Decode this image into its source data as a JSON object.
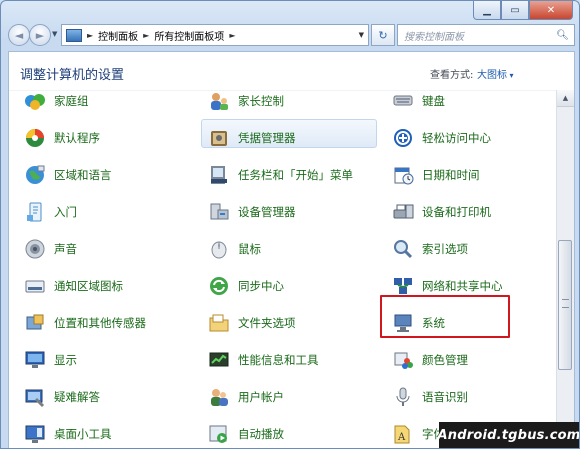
{
  "window": {
    "caption_minimize": "▁",
    "caption_maximize": "▭",
    "caption_close": "✕"
  },
  "nav": {
    "back_glyph": "◄",
    "forward_glyph": "►",
    "breadcrumb": [
      "控制面板",
      "所有控制面板项"
    ],
    "separator": "►",
    "refresh_glyph": "↻"
  },
  "search": {
    "placeholder": "搜索控制面板"
  },
  "header": {
    "title": "调整计算机的设置",
    "view_label": "查看方式:",
    "view_value": "大图标"
  },
  "items": [
    {
      "label": "家庭组",
      "icon": "homegroup-icon"
    },
    {
      "label": "家长控制",
      "icon": "parental-controls-icon"
    },
    {
      "label": "键盘",
      "icon": "keyboard-icon"
    },
    {
      "label": "默认程序",
      "icon": "default-programs-icon"
    },
    {
      "label": "凭据管理器",
      "icon": "credential-manager-icon"
    },
    {
      "label": "轻松访问中心",
      "icon": "ease-of-access-icon"
    },
    {
      "label": "区域和语言",
      "icon": "region-language-icon"
    },
    {
      "label": "任务栏和「开始」菜单",
      "icon": "taskbar-icon"
    },
    {
      "label": "日期和时间",
      "icon": "date-time-icon"
    },
    {
      "label": "入门",
      "icon": "getting-started-icon"
    },
    {
      "label": "设备管理器",
      "icon": "device-manager-icon"
    },
    {
      "label": "设备和打印机",
      "icon": "devices-printers-icon"
    },
    {
      "label": "声音",
      "icon": "sound-icon"
    },
    {
      "label": "鼠标",
      "icon": "mouse-icon"
    },
    {
      "label": "索引选项",
      "icon": "indexing-options-icon"
    },
    {
      "label": "通知区域图标",
      "icon": "notification-area-icon"
    },
    {
      "label": "同步中心",
      "icon": "sync-center-icon"
    },
    {
      "label": "网络和共享中心",
      "icon": "network-sharing-icon"
    },
    {
      "label": "位置和其他传感器",
      "icon": "location-sensors-icon"
    },
    {
      "label": "文件夹选项",
      "icon": "folder-options-icon"
    },
    {
      "label": "系统",
      "icon": "system-icon"
    },
    {
      "label": "显示",
      "icon": "display-icon"
    },
    {
      "label": "性能信息和工具",
      "icon": "performance-icon"
    },
    {
      "label": "颜色管理",
      "icon": "color-management-icon"
    },
    {
      "label": "疑难解答",
      "icon": "troubleshooting-icon"
    },
    {
      "label": "用户帐户",
      "icon": "user-accounts-icon"
    },
    {
      "label": "语音识别",
      "icon": "speech-recognition-icon"
    },
    {
      "label": "桌面小工具",
      "icon": "desktop-gadgets-icon"
    },
    {
      "label": "自动播放",
      "icon": "autoplay-icon"
    },
    {
      "label": "字体",
      "icon": "fonts-icon"
    }
  ],
  "watermark": "Android.tgbus.com"
}
